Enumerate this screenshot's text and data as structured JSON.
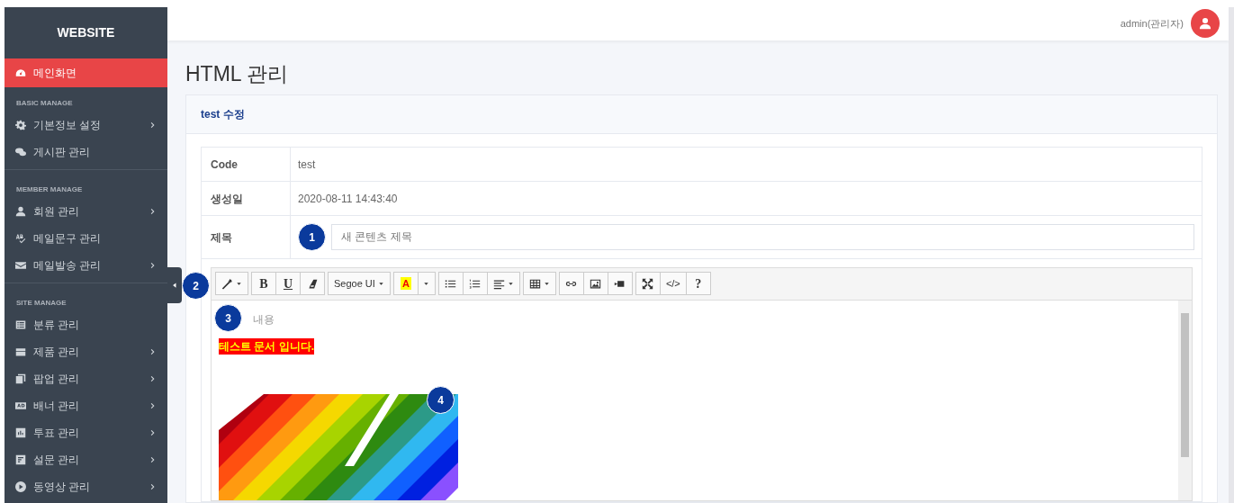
{
  "sidebar": {
    "logo": "WEBSITE",
    "items": [
      {
        "kind": "item",
        "label": "메인화면",
        "selected": true,
        "submenu": false
      },
      {
        "kind": "section",
        "label": "BASIC MANAGE"
      },
      {
        "kind": "item",
        "label": "기본정보 설정",
        "selected": false,
        "submenu": true
      },
      {
        "kind": "item",
        "label": "게시판 관리",
        "selected": false,
        "submenu": false
      },
      {
        "kind": "divider"
      },
      {
        "kind": "section",
        "label": "MEMBER MANAGE"
      },
      {
        "kind": "item",
        "label": "회원 관리",
        "selected": false,
        "submenu": true
      },
      {
        "kind": "item",
        "label": "메일문구 관리",
        "selected": false,
        "submenu": false
      },
      {
        "kind": "item",
        "label": "메일발송 관리",
        "selected": false,
        "submenu": true
      },
      {
        "kind": "divider"
      },
      {
        "kind": "section",
        "label": "SITE MANAGE"
      },
      {
        "kind": "item",
        "label": "분류 관리",
        "selected": false,
        "submenu": false
      },
      {
        "kind": "item",
        "label": "제품 관리",
        "selected": false,
        "submenu": true
      },
      {
        "kind": "item",
        "label": "팝업 관리",
        "selected": false,
        "submenu": true
      },
      {
        "kind": "item",
        "label": "배너 관리",
        "selected": false,
        "submenu": true
      },
      {
        "kind": "item",
        "label": "투표 관리",
        "selected": false,
        "submenu": true
      },
      {
        "kind": "item",
        "label": "설문 관리",
        "selected": false,
        "submenu": true
      },
      {
        "kind": "item",
        "label": "동영상 관리",
        "selected": false,
        "submenu": true
      }
    ]
  },
  "header": {
    "user": "admin(관리자)"
  },
  "page_title": "HTML 관리",
  "card": {
    "title": "test 수정",
    "rows": [
      {
        "kind": "text",
        "label": "Code",
        "value": "test"
      },
      {
        "kind": "text",
        "label": "생성일",
        "value": "2020-08-11 14:43:40"
      },
      {
        "kind": "input",
        "label": "제목",
        "value": "새 콘텐츠 제목"
      }
    ],
    "editor": {
      "toolbar": [
        [
          {
            "kind": "icon",
            "dropdown": true
          }
        ],
        [
          {
            "kind": "bold",
            "text": "B"
          },
          {
            "kind": "underline",
            "text": "U"
          },
          {
            "kind": "icon",
            "dropdown": false
          }
        ],
        [
          {
            "kind": "text",
            "text": "Segoe UI",
            "dropdown": true
          }
        ],
        [
          {
            "kind": "color",
            "text": "A",
            "dropdown": false
          },
          {
            "kind": "caret"
          }
        ],
        [
          {
            "kind": "icon",
            "dropdown": false
          },
          {
            "kind": "icon",
            "dropdown": false
          },
          {
            "kind": "icon",
            "dropdown": true
          }
        ],
        [
          {
            "kind": "icon",
            "dropdown": true
          }
        ],
        [
          {
            "kind": "icon",
            "dropdown": false
          },
          {
            "kind": "icon",
            "dropdown": false
          },
          {
            "kind": "icon",
            "dropdown": false
          }
        ],
        [
          {
            "kind": "icon",
            "dropdown": false
          },
          {
            "kind": "code",
            "text": "</>"
          },
          {
            "kind": "bold",
            "text": "?"
          }
        ]
      ],
      "placeholder": "내용",
      "highlight": "테스트 문서 입니다.",
      "image": {
        "kind": "picture"
      }
    }
  },
  "callouts": [
    "1",
    "2",
    "3",
    "4"
  ]
}
